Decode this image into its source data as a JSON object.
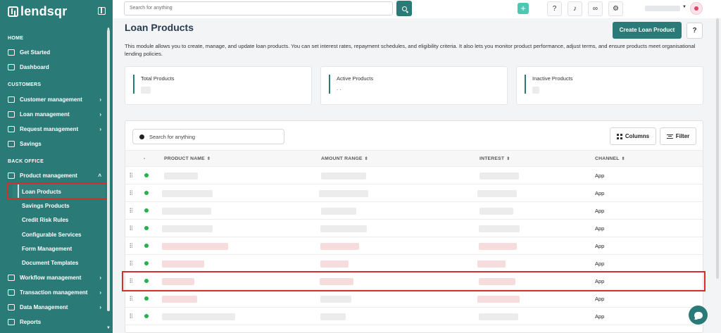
{
  "app": {
    "logo_text": "lendsqr"
  },
  "sidebar": {
    "sections": {
      "home": "HOME",
      "customers": "CUSTOMERS",
      "back_office": "BACK OFFICE"
    },
    "home_items": [
      {
        "label": "Get Started",
        "icon": "rocket-icon"
      },
      {
        "label": "Dashboard",
        "icon": "dashboard-icon"
      }
    ],
    "customer_items": [
      {
        "label": "Customer management",
        "icon": "users-icon"
      },
      {
        "label": "Loan management",
        "icon": "loan-icon"
      },
      {
        "label": "Request management",
        "icon": "request-icon"
      },
      {
        "label": "Savings",
        "icon": "savings-icon"
      }
    ],
    "product_management": {
      "label": "Product management",
      "icon": "product-icon"
    },
    "product_sub_items": [
      "Loan Products",
      "Savings Products",
      "Credit Risk Rules",
      "Configurable Services",
      "Form Management",
      "Document Templates"
    ],
    "bottom_items": [
      {
        "label": "Workflow management",
        "icon": "workflow-icon"
      },
      {
        "label": "Transaction management",
        "icon": "transaction-icon"
      },
      {
        "label": "Data Management",
        "icon": "data-icon"
      },
      {
        "label": "Reports",
        "icon": "reports-icon"
      }
    ]
  },
  "topbar": {
    "search_placeholder": "Search for anything"
  },
  "page": {
    "title": "Loan Products",
    "create_button": "Create Loan Product",
    "description": "This module allows you to create, manage, and update loan products. You can set interest rates, repayment schedules, and eligibility criteria. It also lets you monitor product performance, adjust terms, and ensure products meet organisational lending policies."
  },
  "stats": [
    {
      "label": "Total Products"
    },
    {
      "label": "Active Products",
      "value": ". ."
    },
    {
      "label": "Inactive Products"
    }
  ],
  "table": {
    "search_placeholder": "Search for anything",
    "columns_button": "Columns",
    "filter_button": "Filter",
    "headers": [
      "-",
      "PRODUCT NAME",
      "AMOUNT RANGE",
      "INTEREST",
      "CHANNEL"
    ],
    "rows": [
      {
        "channel": "App",
        "status": "active"
      },
      {
        "channel": "App",
        "status": "active"
      },
      {
        "channel": "App",
        "status": "active"
      },
      {
        "channel": "App",
        "status": "active"
      },
      {
        "channel": "App",
        "status": "active"
      },
      {
        "channel": "App",
        "status": "active"
      },
      {
        "channel": "App",
        "status": "active"
      },
      {
        "channel": "App",
        "status": "active"
      },
      {
        "channel": "App",
        "status": "active"
      }
    ]
  },
  "colors": {
    "brand": "#2a7b78",
    "highlight": "#d32f2f",
    "status_active": "#23b34a"
  }
}
